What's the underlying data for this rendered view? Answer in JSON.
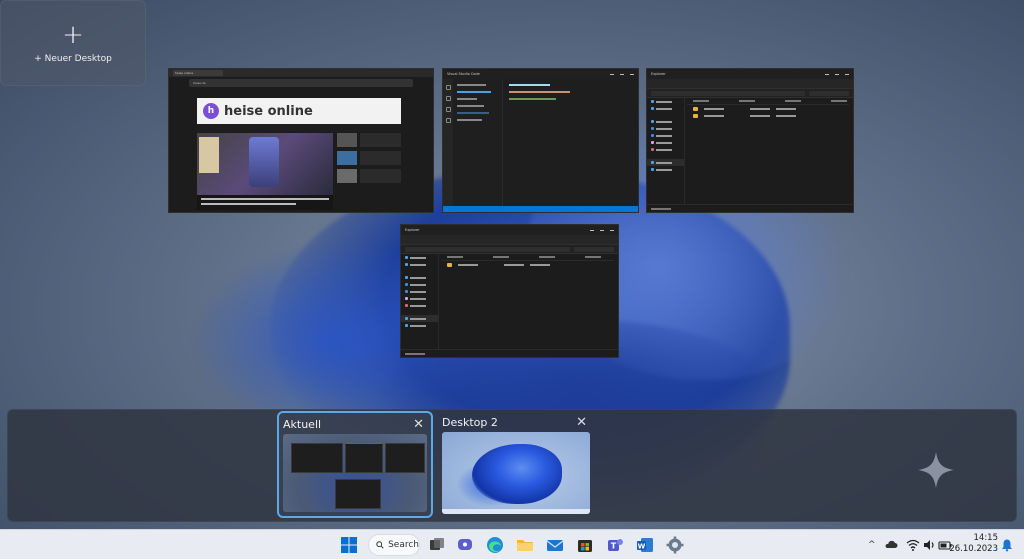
{
  "windows": {
    "browser": {
      "tab_title": "heise online",
      "url": "heise.de",
      "site_title": "heise online",
      "logo_letter": "h"
    },
    "vscode": {
      "title": "Visual Studio Code"
    },
    "explorer1": {
      "title": "Explorer"
    },
    "explorer2": {
      "title": "Explorer"
    }
  },
  "desktops": {
    "current": {
      "label": "Aktuell",
      "close": "✕"
    },
    "desktop2": {
      "label": "Desktop 2",
      "close": "✕"
    },
    "new": {
      "plus": "+",
      "label": "+ Neuer Desktop"
    }
  },
  "taskbar": {
    "search_label": "Search",
    "tray_chevron": "^",
    "time": "14:15",
    "date": "26.10.2023"
  },
  "colors": {
    "accent": "#5da9e8",
    "vscode_status": "#0078d4",
    "taskbar_bg": "#e8ecf2"
  }
}
